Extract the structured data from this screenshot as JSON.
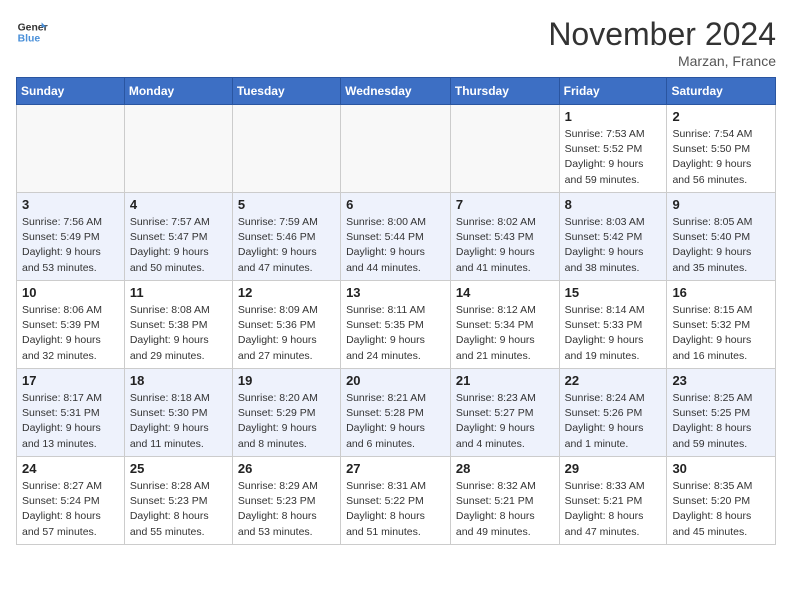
{
  "header": {
    "logo_line1": "General",
    "logo_line2": "Blue",
    "month_title": "November 2024",
    "location": "Marzan, France"
  },
  "weekdays": [
    "Sunday",
    "Monday",
    "Tuesday",
    "Wednesday",
    "Thursday",
    "Friday",
    "Saturday"
  ],
  "weeks": [
    [
      {
        "day": "",
        "info": ""
      },
      {
        "day": "",
        "info": ""
      },
      {
        "day": "",
        "info": ""
      },
      {
        "day": "",
        "info": ""
      },
      {
        "day": "",
        "info": ""
      },
      {
        "day": "1",
        "info": "Sunrise: 7:53 AM\nSunset: 5:52 PM\nDaylight: 9 hours\nand 59 minutes."
      },
      {
        "day": "2",
        "info": "Sunrise: 7:54 AM\nSunset: 5:50 PM\nDaylight: 9 hours\nand 56 minutes."
      }
    ],
    [
      {
        "day": "3",
        "info": "Sunrise: 7:56 AM\nSunset: 5:49 PM\nDaylight: 9 hours\nand 53 minutes."
      },
      {
        "day": "4",
        "info": "Sunrise: 7:57 AM\nSunset: 5:47 PM\nDaylight: 9 hours\nand 50 minutes."
      },
      {
        "day": "5",
        "info": "Sunrise: 7:59 AM\nSunset: 5:46 PM\nDaylight: 9 hours\nand 47 minutes."
      },
      {
        "day": "6",
        "info": "Sunrise: 8:00 AM\nSunset: 5:44 PM\nDaylight: 9 hours\nand 44 minutes."
      },
      {
        "day": "7",
        "info": "Sunrise: 8:02 AM\nSunset: 5:43 PM\nDaylight: 9 hours\nand 41 minutes."
      },
      {
        "day": "8",
        "info": "Sunrise: 8:03 AM\nSunset: 5:42 PM\nDaylight: 9 hours\nand 38 minutes."
      },
      {
        "day": "9",
        "info": "Sunrise: 8:05 AM\nSunset: 5:40 PM\nDaylight: 9 hours\nand 35 minutes."
      }
    ],
    [
      {
        "day": "10",
        "info": "Sunrise: 8:06 AM\nSunset: 5:39 PM\nDaylight: 9 hours\nand 32 minutes."
      },
      {
        "day": "11",
        "info": "Sunrise: 8:08 AM\nSunset: 5:38 PM\nDaylight: 9 hours\nand 29 minutes."
      },
      {
        "day": "12",
        "info": "Sunrise: 8:09 AM\nSunset: 5:36 PM\nDaylight: 9 hours\nand 27 minutes."
      },
      {
        "day": "13",
        "info": "Sunrise: 8:11 AM\nSunset: 5:35 PM\nDaylight: 9 hours\nand 24 minutes."
      },
      {
        "day": "14",
        "info": "Sunrise: 8:12 AM\nSunset: 5:34 PM\nDaylight: 9 hours\nand 21 minutes."
      },
      {
        "day": "15",
        "info": "Sunrise: 8:14 AM\nSunset: 5:33 PM\nDaylight: 9 hours\nand 19 minutes."
      },
      {
        "day": "16",
        "info": "Sunrise: 8:15 AM\nSunset: 5:32 PM\nDaylight: 9 hours\nand 16 minutes."
      }
    ],
    [
      {
        "day": "17",
        "info": "Sunrise: 8:17 AM\nSunset: 5:31 PM\nDaylight: 9 hours\nand 13 minutes."
      },
      {
        "day": "18",
        "info": "Sunrise: 8:18 AM\nSunset: 5:30 PM\nDaylight: 9 hours\nand 11 minutes."
      },
      {
        "day": "19",
        "info": "Sunrise: 8:20 AM\nSunset: 5:29 PM\nDaylight: 9 hours\nand 8 minutes."
      },
      {
        "day": "20",
        "info": "Sunrise: 8:21 AM\nSunset: 5:28 PM\nDaylight: 9 hours\nand 6 minutes."
      },
      {
        "day": "21",
        "info": "Sunrise: 8:23 AM\nSunset: 5:27 PM\nDaylight: 9 hours\nand 4 minutes."
      },
      {
        "day": "22",
        "info": "Sunrise: 8:24 AM\nSunset: 5:26 PM\nDaylight: 9 hours\nand 1 minute."
      },
      {
        "day": "23",
        "info": "Sunrise: 8:25 AM\nSunset: 5:25 PM\nDaylight: 8 hours\nand 59 minutes."
      }
    ],
    [
      {
        "day": "24",
        "info": "Sunrise: 8:27 AM\nSunset: 5:24 PM\nDaylight: 8 hours\nand 57 minutes."
      },
      {
        "day": "25",
        "info": "Sunrise: 8:28 AM\nSunset: 5:23 PM\nDaylight: 8 hours\nand 55 minutes."
      },
      {
        "day": "26",
        "info": "Sunrise: 8:29 AM\nSunset: 5:23 PM\nDaylight: 8 hours\nand 53 minutes."
      },
      {
        "day": "27",
        "info": "Sunrise: 8:31 AM\nSunset: 5:22 PM\nDaylight: 8 hours\nand 51 minutes."
      },
      {
        "day": "28",
        "info": "Sunrise: 8:32 AM\nSunset: 5:21 PM\nDaylight: 8 hours\nand 49 minutes."
      },
      {
        "day": "29",
        "info": "Sunrise: 8:33 AM\nSunset: 5:21 PM\nDaylight: 8 hours\nand 47 minutes."
      },
      {
        "day": "30",
        "info": "Sunrise: 8:35 AM\nSunset: 5:20 PM\nDaylight: 8 hours\nand 45 minutes."
      }
    ]
  ]
}
